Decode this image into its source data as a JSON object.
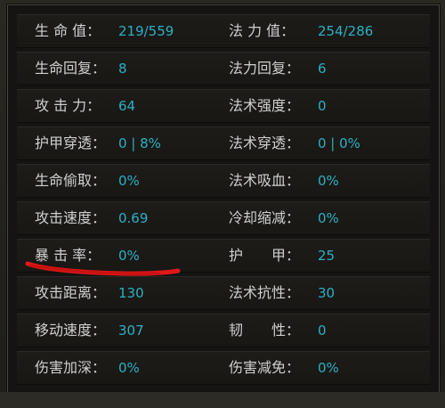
{
  "stats": [
    {
      "left_label": "生 命 值：",
      "left_value": "219/559",
      "right_label": "法 力 值：",
      "right_value": "254/286"
    },
    {
      "left_label": "生命回复：",
      "left_value": "8",
      "right_label": "法力回复：",
      "right_value": "6"
    },
    {
      "left_label": "攻 击 力：",
      "left_value": "64",
      "right_label": "法术强度：",
      "right_value": "0"
    },
    {
      "left_label": "护甲穿透：",
      "left_value": "0 | 8%",
      "right_label": "法术穿透：",
      "right_value": "0 | 0%"
    },
    {
      "left_label": "生命偷取：",
      "left_value": "0%",
      "right_label": "法术吸血：",
      "right_value": "0%"
    },
    {
      "left_label": "攻击速度：",
      "left_value": "0.69",
      "right_label": "冷却缩减：",
      "right_value": "0%"
    },
    {
      "left_label": "暴 击 率：",
      "left_value": "0%",
      "right_label": "护　　甲：",
      "right_value": "25"
    },
    {
      "left_label": "攻击距离：",
      "left_value": "130",
      "right_label": "法术抗性：",
      "right_value": "30"
    },
    {
      "left_label": "移动速度：",
      "left_value": "307",
      "right_label": "韧　　性：",
      "right_value": "0"
    },
    {
      "left_label": "伤害加深：",
      "left_value": "0%",
      "right_label": "伤害减免：",
      "right_value": "0%"
    }
  ],
  "colors": {
    "label": "#cfcfcf",
    "value": "#2cb0c4",
    "annotation": "#e01818"
  },
  "annotation": {
    "type": "red-underline",
    "target": "暴 击 率"
  }
}
